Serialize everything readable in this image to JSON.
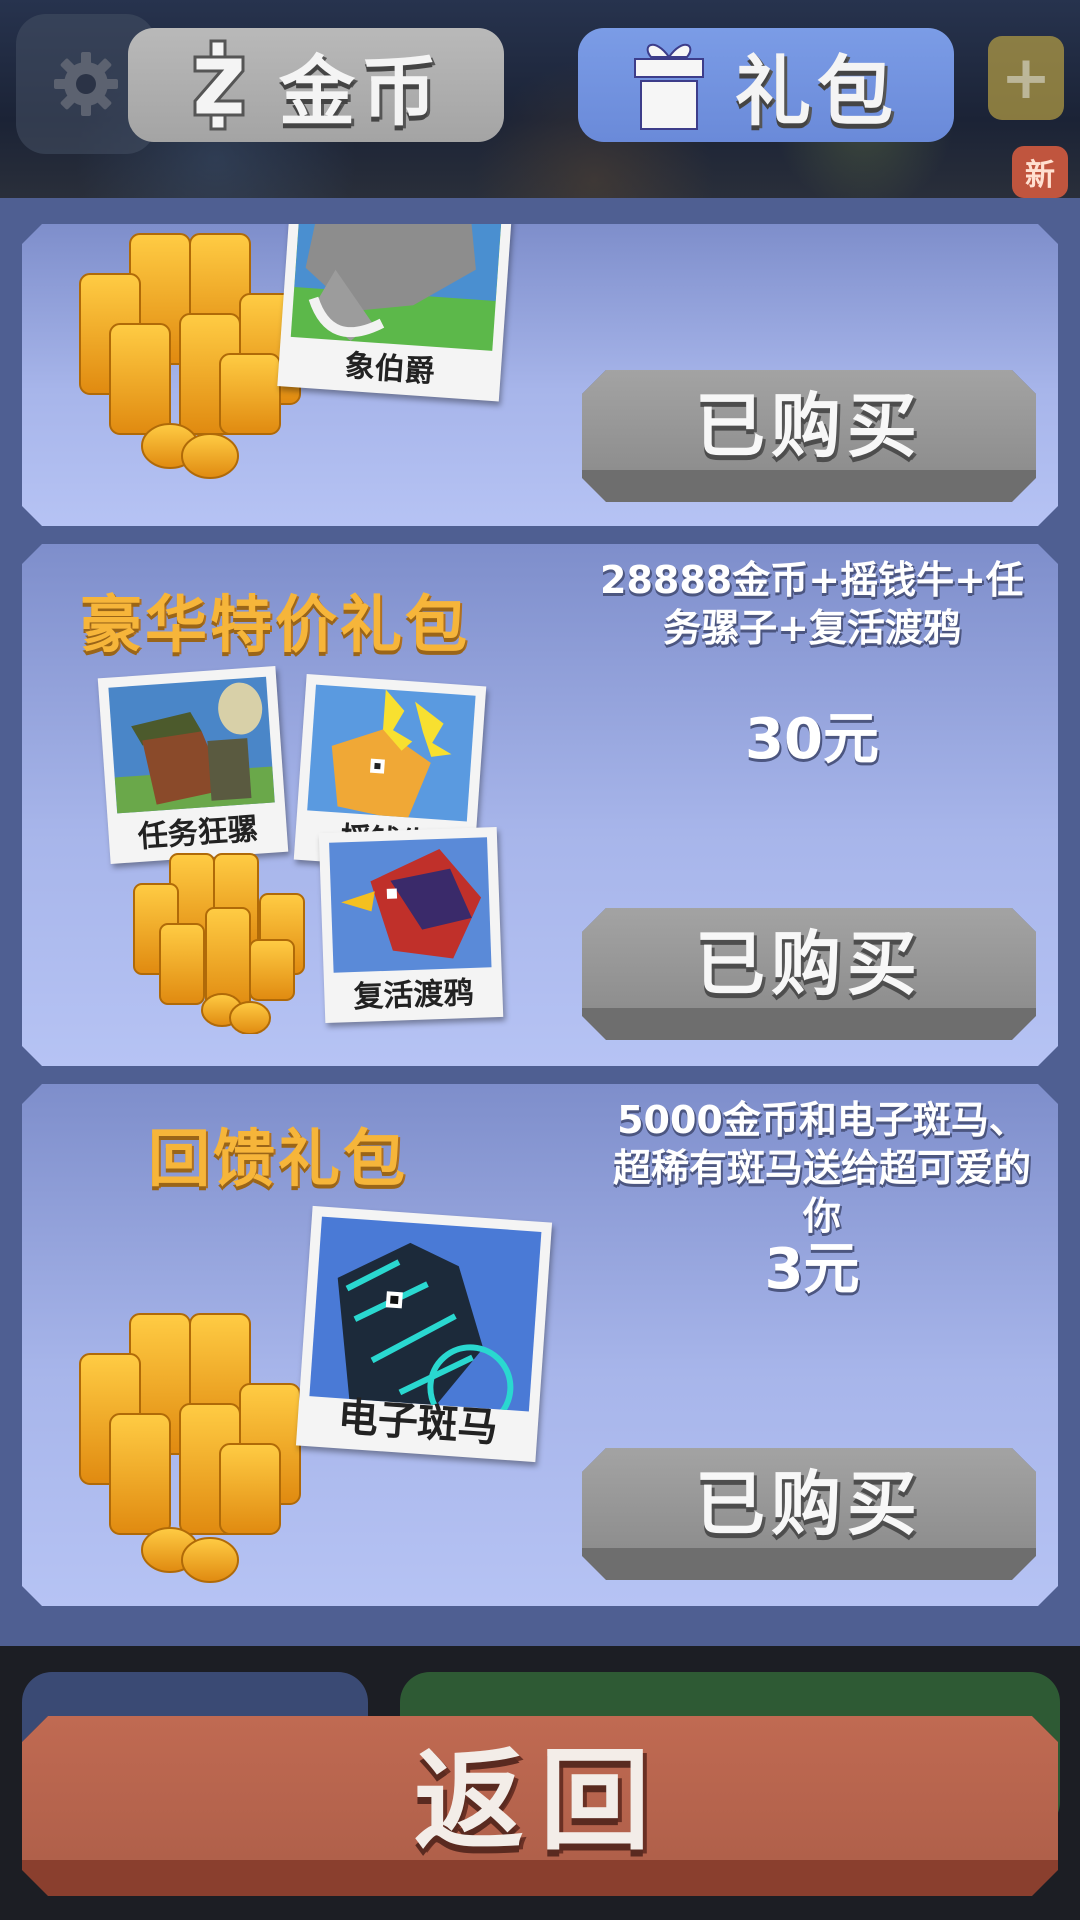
{
  "header": {
    "tabs": [
      {
        "label": "金币",
        "icon": "coin-z-icon",
        "active": false,
        "color": "#b0b0b0"
      },
      {
        "label": "礼包",
        "icon": "gift-icon",
        "active": true,
        "color": "#7393e0"
      }
    ],
    "settings_icon": "gear-icon",
    "add_icon": "plus-icon",
    "new_badge": "新"
  },
  "packs": [
    {
      "title": "",
      "animal_caption": "象伯爵",
      "button_label": "已购买"
    },
    {
      "title": "豪华特价礼包",
      "description": "28888金币+摇钱牛+任务骡子+复活渡鸦",
      "price": "30元",
      "captions": [
        "任务狂骡",
        "摇钱牛",
        "复活渡鸦"
      ],
      "button_label": "已购买"
    },
    {
      "title": "回馈礼包",
      "description": "5000金币和电子斑马、超稀有斑马送给超可爱的你",
      "price": "3元",
      "animal_caption": "电子斑马",
      "button_label": "已购买"
    }
  ],
  "footer": {
    "back_label": "返回"
  },
  "colors": {
    "panel": "#4f5f92",
    "card_top": "#7e8ecb",
    "card_bottom": "#b6c3f4",
    "title_gold": "#f6b53a",
    "bought_gray": "#9a9a9a",
    "back_red": "#b8644d"
  }
}
